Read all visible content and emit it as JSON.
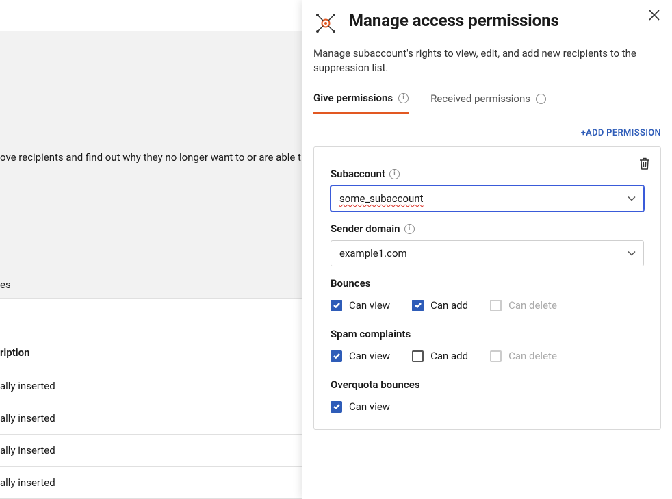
{
  "background": {
    "desc_line": "ove recipients and find out why they no longer want to or are able t",
    "es_line": "es",
    "table_header": "ription",
    "rows": [
      "ally inserted",
      "ally inserted",
      "ally inserted",
      "ally inserted"
    ]
  },
  "panel": {
    "title": "Manage access permissions",
    "subtitle": "Manage subaccount's rights to view, edit, and add new recipients to the suppression list.",
    "tabs": {
      "give": "Give permissions",
      "received": "Received permissions"
    },
    "add_permission": "+ADD PERMISSION",
    "card": {
      "subaccount_label": "Subaccount",
      "subaccount_value": "some_subaccount",
      "domain_label": "Sender domain",
      "domain_value": "example1.com",
      "bounces_heading": "Bounces",
      "spam_heading": "Spam complaints",
      "overquota_heading": "Overquota bounces",
      "can_view": "Can view",
      "can_add": "Can add",
      "can_delete": "Can delete"
    }
  }
}
